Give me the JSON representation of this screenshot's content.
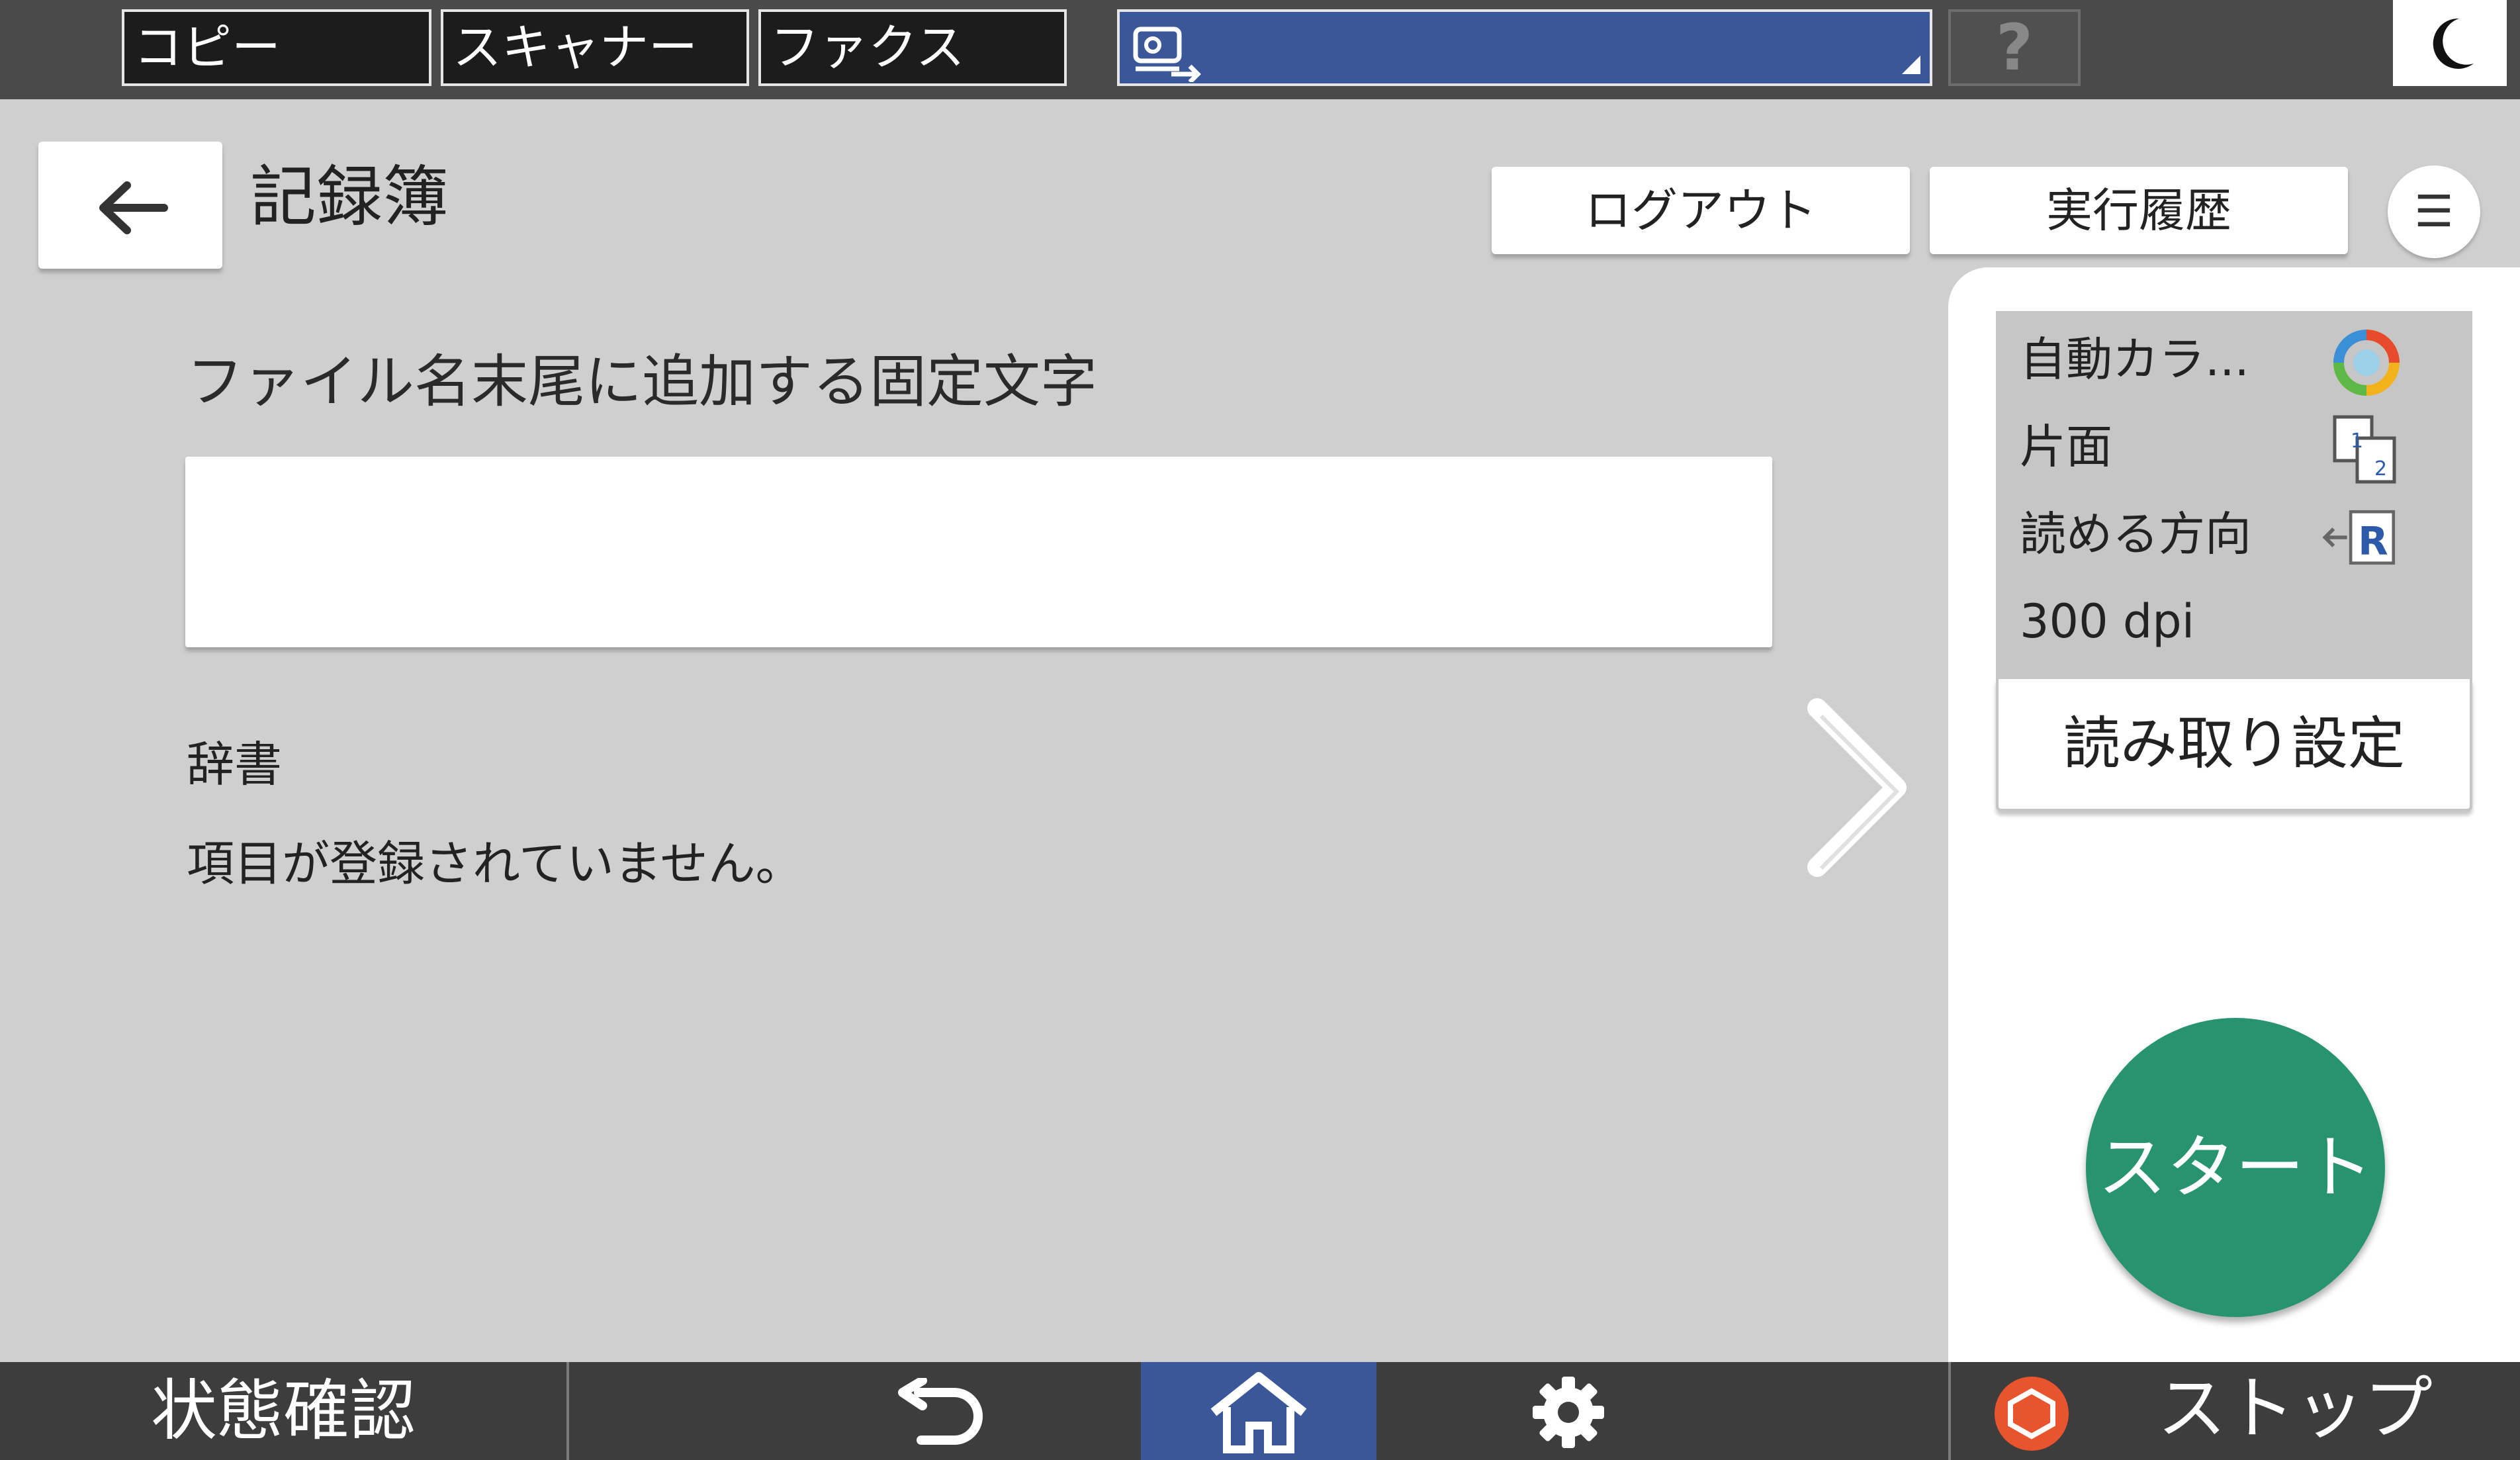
{
  "top_tabs": [
    {
      "label": "コピー"
    },
    {
      "label": "スキャナー"
    },
    {
      "label": "ファクス"
    }
  ],
  "help_label": "?",
  "header": {
    "title": "記録簿",
    "logout_label": "ログアウト",
    "history_label": "実行履歴",
    "menu_label": "☰"
  },
  "main": {
    "field_label": "ファイル名末尾に追加する固定文字",
    "field_value": "",
    "dictionary_label": "辞書",
    "dictionary_empty": "項目が登録されていません。"
  },
  "scan_settings": {
    "color": "自動カラ...",
    "sides": "片面",
    "orientation": "読める方向",
    "resolution": "300 dpi",
    "button_label": "読み取り設定"
  },
  "start_label": "スタート",
  "bottom": {
    "status_label": "状態確認",
    "stop_label": "ストップ"
  },
  "colors": {
    "accent_blue": "#3a5799",
    "start_green": "#27936f",
    "stop_orange": "#e8542e",
    "orientation_blue": "#2c5aa8"
  }
}
